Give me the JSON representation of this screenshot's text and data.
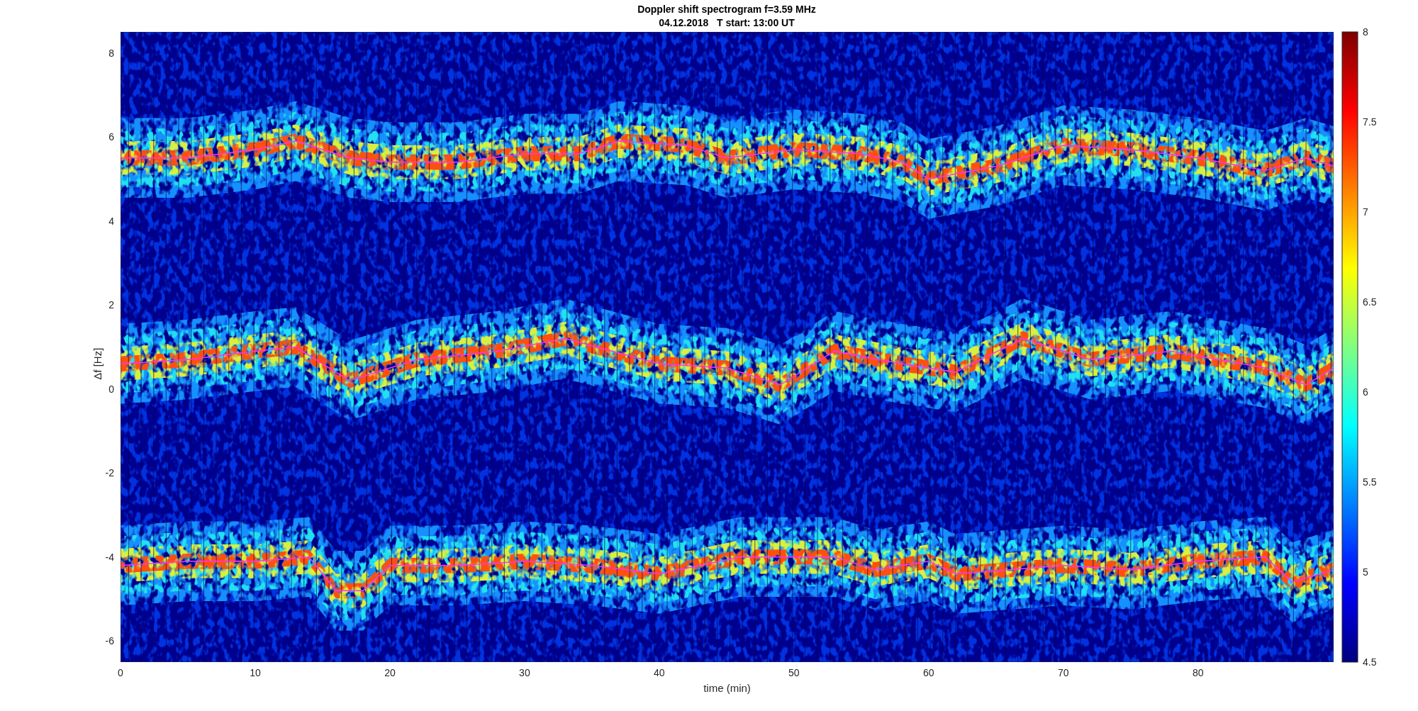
{
  "figure": {
    "title_lines": [
      "Doppler shift spectrogram f=3.59 MHz",
      "04.12.2018   T start: 13:00 UT"
    ],
    "xlabel": "time (min)",
    "ylabel": "Δf [Hz]",
    "xticks": [
      "0",
      "10",
      "20",
      "30",
      "40",
      "50",
      "60",
      "70",
      "80"
    ],
    "yticks": [
      "8",
      "6",
      "4",
      "2",
      "0",
      "-2",
      "-4",
      "-6"
    ],
    "colorbar": {
      "ticks": [
        "8",
        "7.5",
        "7",
        "6.5",
        "6",
        "5.5",
        "5",
        "4.5"
      ]
    }
  }
}
